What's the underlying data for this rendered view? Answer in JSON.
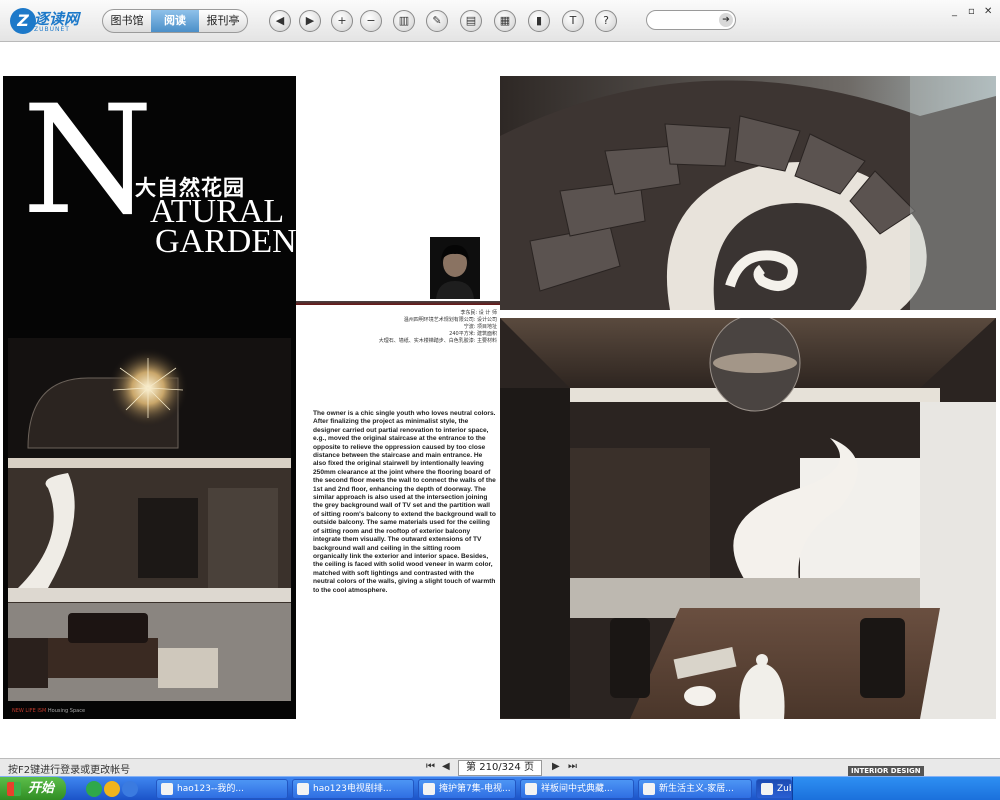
{
  "toolbar": {
    "logo_text": "逐读网",
    "logo_sub": "ZUBUNET",
    "nav_tabs": [
      "图书馆",
      "阅读",
      "报刊亭"
    ],
    "active_tab": "阅读",
    "buttons": [
      {
        "name": "back-icon",
        "glyph": "◀"
      },
      {
        "name": "forward-icon",
        "glyph": "▶"
      },
      {
        "name": "zoom-in-icon",
        "glyph": "+"
      },
      {
        "name": "zoom-out-icon",
        "glyph": "−"
      },
      {
        "name": "book-icon",
        "glyph": "▥"
      },
      {
        "name": "pen-icon",
        "glyph": "✎"
      },
      {
        "name": "print-icon",
        "glyph": "▤"
      },
      {
        "name": "layout-icon",
        "glyph": "▦"
      },
      {
        "name": "bookmark-icon",
        "glyph": "▮"
      },
      {
        "name": "text-icon",
        "glyph": "T"
      },
      {
        "name": "help-icon",
        "glyph": "?"
      }
    ],
    "search_go": "➔",
    "window_controls": [
      "_",
      "▫",
      "✕"
    ]
  },
  "left_page": {
    "big_letter": "N",
    "title_cn": "大自然花园",
    "title_en_line1": "ATURAL",
    "title_en_line2": "GARDEN",
    "footer_magazine": "NEW LIFE ISM",
    "footer_section": "Housing Space"
  },
  "middle_column": {
    "credits": [
      "李东民: 设 计 师",
      "温州四明环境艺术规划有限公司: 设计公司",
      "宁波: 项目地址",
      "240平方米: 建筑面积",
      "大理石、墙纸、实木楼梯踏步、白色乳胶漆: 主要材料"
    ],
    "body": "The owner is a chic single youth who loves neutral colors. After finalizing the project as minimalist style, the designer carried out partial renovation to interior space, e.g., moved the original staircase at the entrance to the opposite to relieve the oppression caused by too close distance between the staircase and main entrance. He also fixed the original stairwell by intentionally leaving 250mm clearance at the joint where the flooring board of the second floor meets the wall to connect the walls of the 1st and 2nd floor, enhancing the depth of doorway. The similar approach is also used at the intersection joining the grey background wall of TV set and the partition wall of sitting room's balcony to extend the background wall to outside balcony. The same materials used for the ceiling of sitting room and the rooftop of exterior balcony integrate them visually. The outward extensions of TV background wall and ceiling in the sitting room organically link the exterior and interior space. Besides, the ceiling is faced with solid wood veneer in warm color, matched with soft lightings and contrasted with the neutral colors of the walls, giving a slight touch of warmth to the cool atmosphere."
  },
  "statusbar": {
    "message": "按F2键进行登录或更改帐号",
    "page_indicator": "第 210/324 页",
    "pager_first": "⏮",
    "pager_prev": "◀",
    "pager_next": "▶",
    "pager_last": "⏭"
  },
  "taskbar": {
    "start_label": "开始",
    "tasks": [
      {
        "label": "hao123--我的..."
      },
      {
        "label": "hao123电视剧排..."
      },
      {
        "label": "掩护第7集-电视..."
      },
      {
        "label": "祥板间中式典藏..."
      },
      {
        "label": "新生活主义-家居..."
      },
      {
        "label": "Zubu Reader"
      }
    ],
    "active_task": "Zubu Reader",
    "tray_watermark": "INTERIOR DESIGN"
  },
  "colors": {
    "accent": "#1d79c9",
    "active_tab": "#4b8fc8",
    "taskbar": "#245edb",
    "start": "#3a9b2e",
    "page_black": "#050505",
    "divider_red": "#6b1515"
  }
}
